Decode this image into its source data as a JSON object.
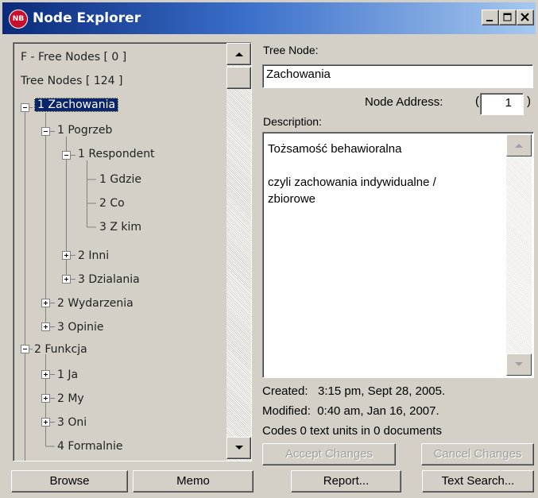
{
  "window": {
    "title": "Node Explorer",
    "icon_text": "NB"
  },
  "tree": {
    "rows": [
      {
        "text": "F - Free Nodes [ 0 ]"
      },
      {
        "text": "Tree Nodes [ 124 ]"
      },
      {
        "text": "1  Zachowania"
      },
      {
        "text": "1  Pogrzeb"
      },
      {
        "text": "1  Respondent"
      },
      {
        "text": "1  Gdzie"
      },
      {
        "text": "2  Co"
      },
      {
        "text": "3  Z kim"
      },
      {
        "text": "2  Inni"
      },
      {
        "text": "3  Dzialania"
      },
      {
        "text": "2  Wydarzenia"
      },
      {
        "text": "3  Opinie"
      },
      {
        "text": "2  Funkcja"
      },
      {
        "text": "1  Ja"
      },
      {
        "text": "2  My"
      },
      {
        "text": "3  Oni"
      },
      {
        "text": "4  Formalnie"
      }
    ]
  },
  "details": {
    "tree_node_label": "Tree Node:",
    "tree_node_value": "Zachowania",
    "node_address_label": "Node Address:",
    "node_address_value": "1",
    "description_label": "Description:",
    "description_value": "Tożsamość behawioralna\n\nczyli zachowania indywidualne /\nzbiorowe",
    "created": "Created:   3:15 pm, Sept 28, 2005.",
    "modified": "Modified:  0:40 am, Jan 16, 2007.",
    "codes": "Codes 0 text units in 0 documents"
  },
  "buttons": {
    "accept": "Accept Changes",
    "cancel": "Cancel Changes",
    "browse": "Browse",
    "memo": "Memo",
    "report": "Report...",
    "text_search": "Text Search..."
  }
}
